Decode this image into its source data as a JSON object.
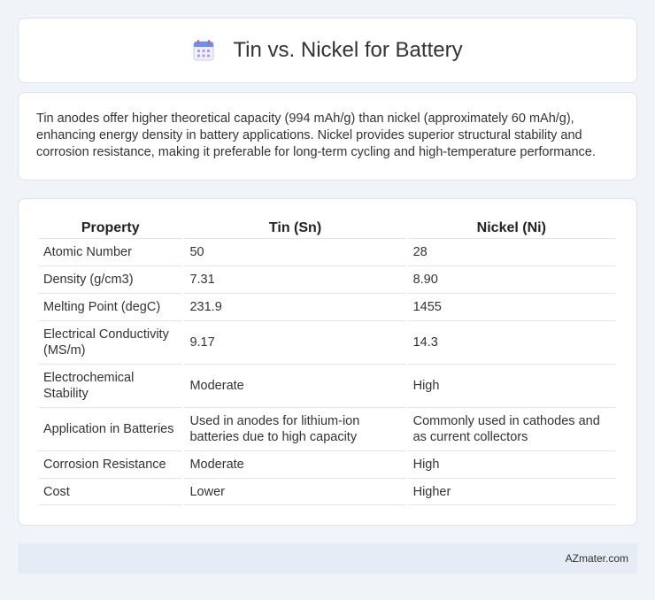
{
  "header": {
    "icon": "calendar-icon",
    "title": "Tin vs. Nickel for Battery"
  },
  "summary": {
    "text": "Tin anodes offer higher theoretical capacity (994 mAh/g) than nickel (approximately 60 mAh/g), enhancing energy density in battery applications. Nickel provides superior structural stability and corrosion resistance, making it preferable for long-term cycling and high-temperature performance."
  },
  "table": {
    "headers": [
      "Property",
      "Tin (Sn)",
      "Nickel (Ni)"
    ],
    "rows": [
      [
        "Atomic Number",
        "50",
        "28"
      ],
      [
        "Density (g/cm3)",
        "7.31",
        "8.90"
      ],
      [
        "Melting Point (degC)",
        "231.9",
        "1455"
      ],
      [
        "Electrical Conductivity (MS/m)",
        "9.17",
        "14.3"
      ],
      [
        "Electrochemical Stability",
        "Moderate",
        "High"
      ],
      [
        "Application in Batteries",
        "Used in anodes for lithium-ion batteries due to high capacity",
        "Commonly used in cathodes and as current collectors"
      ],
      [
        "Corrosion Resistance",
        "Moderate",
        "High"
      ],
      [
        "Cost",
        "Lower",
        "Higher"
      ]
    ]
  },
  "footer": {
    "text": "AZmater.com"
  }
}
